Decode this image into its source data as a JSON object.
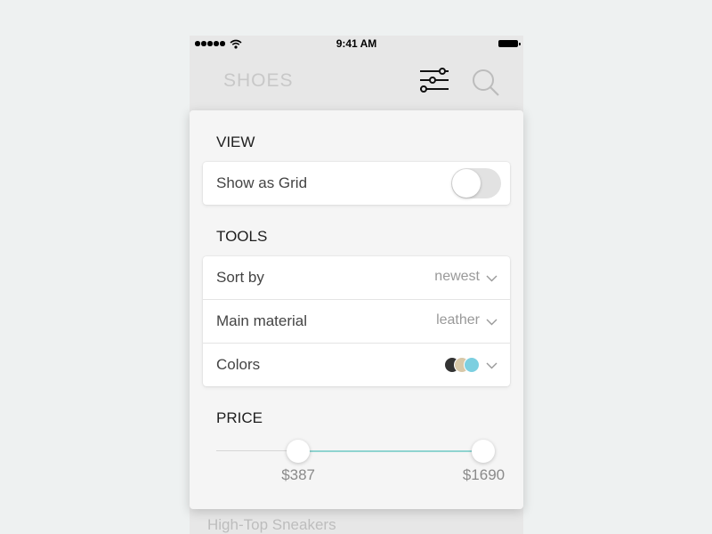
{
  "status_bar": {
    "time": "9:41 AM"
  },
  "nav": {
    "title": "SHOES",
    "filter_icon": "sliders-icon",
    "search_icon": "search-icon"
  },
  "background_list": {
    "visible_item": "High-Top Sneakers"
  },
  "filters": {
    "view": {
      "title": "VIEW",
      "show_as_grid_label": "Show as Grid",
      "show_as_grid_on": false
    },
    "tools": {
      "title": "TOOLS",
      "sort_by": {
        "label": "Sort by",
        "value": "newest"
      },
      "material": {
        "label": "Main material",
        "value": "leather"
      },
      "colors": {
        "label": "Colors",
        "swatches": [
          "#333333",
          "#d8c8a8",
          "#7ccfe0"
        ]
      }
    },
    "price": {
      "title": "PRICE",
      "min_label": "$387",
      "max_label": "$1690",
      "min_fraction": 0.305,
      "max_fraction": 0.995
    }
  },
  "colors": {
    "accent": "#8fd3d0",
    "background": "#eef1f1"
  }
}
